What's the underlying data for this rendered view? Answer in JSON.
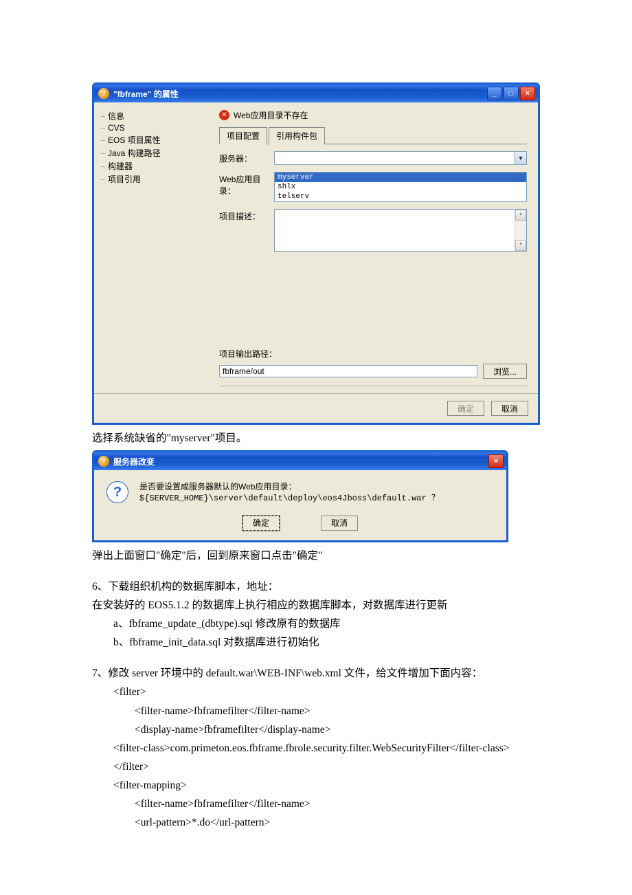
{
  "dialog1": {
    "title": "\"fbframe\" 的属性",
    "tree": [
      "信息",
      "CVS",
      "EOS 项目属性",
      "Java 构建路径",
      "构建器",
      "项目引用"
    ],
    "error": "Web应用目录不存在",
    "tabs": {
      "active": "项目配置",
      "inactive": "引用构件包"
    },
    "labels": {
      "server": "服务器：",
      "webdir": "Web应用目录：",
      "desc": "项目描述：",
      "outpath": "项目输出路径："
    },
    "list_items": [
      "myserver",
      "shlx",
      "telserv"
    ],
    "output_path": "fbframe/out",
    "browse": "浏览...",
    "ok": "确定",
    "cancel": "取消"
  },
  "caption1": "选择系统缺省的\"myserver\"项目。",
  "dialog2": {
    "title": "服务器改变",
    "msg_line1": "是否要设置成服务器默认的Web应用目录：",
    "msg_line2": "${SERVER_HOME}\\server\\default\\deploy\\eos4Jboss\\default.war ？",
    "ok": "确定",
    "cancel": "取消"
  },
  "doc": {
    "caption2": "弹出上面窗口\"确定\"后，回到原来窗口点击\"确定\"",
    "p6_1": "6、下载组织机构的数据库脚本，地址：",
    "p6_2": "在安装好的 EOS5.1.2 的数据库上执行相应的数据库脚本，对数据库进行更新",
    "p6_a": "a、fbframe_update_(dbtype).sql  修改原有的数据库",
    "p6_b": "b、fbframe_init_data.sql  对数据库进行初始化",
    "p7_1": "7、修改 server 环境中的 default.war\\WEB-INF\\web.xml 文件，给文件增加下面内容：",
    "x1": "<filter>",
    "x2": "<filter-name>fbframefilter</filter-name>",
    "x3": "<display-name>fbframefilter</display-name>",
    "x4": "<filter-class>com.primeton.eos.fbframe.fbrole.security.filter.WebSecurityFilter</filter-class>",
    "x5": "</filter>",
    "x6": "<filter-mapping>",
    "x7": "<filter-name>fbframefilter</filter-name>",
    "x8": "<url-pattern>*.do</url-pattern>"
  }
}
